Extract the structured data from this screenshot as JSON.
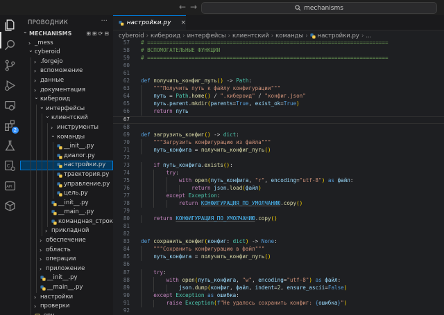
{
  "search": {
    "text": "mechanisms"
  },
  "nav": {
    "back": "←",
    "forward": "→"
  },
  "activity": {
    "badge": "2"
  },
  "sidebar": {
    "title": "ПРОВОДНИК",
    "more": "···",
    "rows": [
      {
        "label": "MECHANISMS",
        "depth": 0,
        "kind": "root",
        "open": true
      },
      {
        "label": "_mess",
        "depth": 1,
        "kind": "folder",
        "open": false
      },
      {
        "label": "cyberoid",
        "depth": 1,
        "kind": "folder",
        "open": true
      },
      {
        "label": ".forgejo",
        "depth": 2,
        "kind": "folder",
        "open": false
      },
      {
        "label": "вспоможение",
        "depth": 2,
        "kind": "folder",
        "open": false
      },
      {
        "label": "данные",
        "depth": 2,
        "kind": "folder",
        "open": false
      },
      {
        "label": "документация",
        "depth": 2,
        "kind": "folder",
        "open": false
      },
      {
        "label": "кибероид",
        "depth": 2,
        "kind": "folder",
        "open": true
      },
      {
        "label": "интерфейсы",
        "depth": 3,
        "kind": "folder",
        "open": true
      },
      {
        "label": "клиентский",
        "depth": 4,
        "kind": "folder",
        "open": true
      },
      {
        "label": "инструменты",
        "depth": 5,
        "kind": "folder",
        "open": false
      },
      {
        "label": "команды",
        "depth": 5,
        "kind": "folder",
        "open": true
      },
      {
        "label": "__init__.py",
        "depth": 6,
        "kind": "py"
      },
      {
        "label": "диалог.py",
        "depth": 6,
        "kind": "py"
      },
      {
        "label": "настройки.py",
        "depth": 6,
        "kind": "py",
        "selected": true
      },
      {
        "label": "траектория.py",
        "depth": 6,
        "kind": "py"
      },
      {
        "label": "управление.py",
        "depth": 6,
        "kind": "py"
      },
      {
        "label": "цель.py",
        "depth": 6,
        "kind": "py"
      },
      {
        "label": "__init__.py",
        "depth": 5,
        "kind": "py"
      },
      {
        "label": "__main__.py",
        "depth": 5,
        "kind": "py"
      },
      {
        "label": "командная_строка.py",
        "depth": 5,
        "kind": "py"
      },
      {
        "label": "прикладной",
        "depth": 4,
        "kind": "folder",
        "open": false
      },
      {
        "label": "обеспечение",
        "depth": 3,
        "kind": "folder",
        "open": false
      },
      {
        "label": "область",
        "depth": 3,
        "kind": "folder",
        "open": false
      },
      {
        "label": "операции",
        "depth": 3,
        "kind": "folder",
        "open": false
      },
      {
        "label": "приложение",
        "depth": 3,
        "kind": "folder",
        "open": false
      },
      {
        "label": "__init__.py",
        "depth": 3,
        "kind": "py"
      },
      {
        "label": "__main__.py",
        "depth": 3,
        "kind": "py"
      },
      {
        "label": "настройки",
        "depth": 2,
        "kind": "folder",
        "open": false
      },
      {
        "label": "проверки",
        "depth": 2,
        "kind": "folder",
        "open": false
      },
      {
        "label": ".env",
        "depth": 2,
        "kind": "file"
      }
    ]
  },
  "editor": {
    "tab_label": "настройки.py",
    "tab_close": "×",
    "breadcrumb": [
      "cyberoid",
      "кибероид",
      "интерфейсы",
      "клиентский",
      "команды",
      "настройки.py",
      "..."
    ],
    "current_line": 67,
    "lines": [
      {
        "n": 57,
        "code": "# ============================================================================",
        "cls": "c"
      },
      {
        "n": 58,
        "code": "# ВСПОМОГАТЕЛЬНЫЕ ФУНКЦИИ",
        "cls": "c"
      },
      {
        "n": 59,
        "code": "# ============================================================================",
        "cls": "c"
      },
      {
        "n": 60,
        "code": ""
      },
      {
        "n": 61,
        "code": ""
      },
      {
        "n": 62,
        "code": "def получить_конфиг_путь() -> Path:"
      },
      {
        "n": 63,
        "code": "    \"\"\"Получить путь к файлу конфигурации\"\"\""
      },
      {
        "n": 64,
        "code": "    путь = Path.home() / \".кибероид\" / \"конфиг.json\""
      },
      {
        "n": 65,
        "code": "    путь.parent.mkdir(parents=True, exist_ok=True)"
      },
      {
        "n": 66,
        "code": "    return путь"
      },
      {
        "n": 67,
        "code": ""
      },
      {
        "n": 68,
        "code": ""
      },
      {
        "n": 69,
        "code": "def загрузить_конфиг() -> dict:"
      },
      {
        "n": 70,
        "code": "    \"\"\"Загрузить конфигурацию из файла\"\"\""
      },
      {
        "n": 71,
        "code": "    путь_конфига = получить_конфиг_путь()"
      },
      {
        "n": 72,
        "code": ""
      },
      {
        "n": 73,
        "code": "    if путь_конфига.exists():"
      },
      {
        "n": 74,
        "code": "        try:"
      },
      {
        "n": 75,
        "code": "            with open(путь_конфига, \"r\", encoding=\"utf-8\") as файл:"
      },
      {
        "n": 76,
        "code": "                return json.load(файл)"
      },
      {
        "n": 77,
        "code": "        except Exception:"
      },
      {
        "n": 78,
        "code": "            return КОНФИГУРАЦИЯ_ПО_УМОЛЧАНИЮ.copy()"
      },
      {
        "n": 79,
        "code": ""
      },
      {
        "n": 80,
        "code": "    return КОНФИГУРАЦИЯ_ПО_УМОЛЧАНИЮ.copy()"
      },
      {
        "n": 81,
        "code": ""
      },
      {
        "n": 82,
        "code": ""
      },
      {
        "n": 83,
        "code": "def сохранить_конфиг(конфиг: dict) -> None:"
      },
      {
        "n": 84,
        "code": "    \"\"\"Сохранить конфигурацию в файл\"\"\""
      },
      {
        "n": 85,
        "code": "    путь_конфига = получить_конфиг_путь()"
      },
      {
        "n": 86,
        "code": ""
      },
      {
        "n": 87,
        "code": "    try:"
      },
      {
        "n": 88,
        "code": "        with open(путь_конфига, \"w\", encoding=\"utf-8\") as файл:"
      },
      {
        "n": 89,
        "code": "            json.dump(конфиг, файл, indent=2, ensure_ascii=False)"
      },
      {
        "n": 90,
        "code": "    except Exception as ошибка:"
      },
      {
        "n": 91,
        "code": "        raise Exception(f\"Не удалось сохранить конфиг: {ошибка}\")"
      },
      {
        "n": 92,
        "code": ""
      }
    ]
  },
  "colors": {
    "accent": "#0078d4",
    "selection": "#04395e",
    "badge": "#3794ff"
  }
}
